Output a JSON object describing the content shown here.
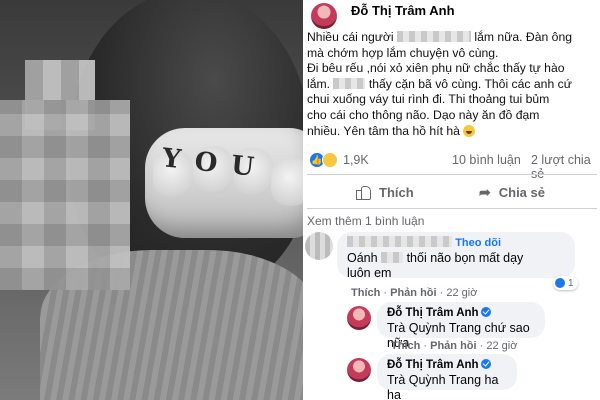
{
  "post": {
    "author": "Đỗ Thị Trâm Anh",
    "text": {
      "line1_a": "Nhiều cái người",
      "line1_b": "lắm nữa. Đàn ông",
      "line2": "mà chớm hợp lắm chuyện vô cùng.",
      "line3": "Đi bêu rếu ,nói xỏ xiên phụ nữ chắc thấy tự hào",
      "line4_a": "lắm.",
      "line4_b": "thấy cặn bã vô cùng. Thôi các anh cứ",
      "line5": "chui xuống váy tui rình đi. Thi thoảng tui bủm",
      "line6": "cho cái cho thông não. Dạo này ăn đồ đạm",
      "line7": "nhiều. Yên tâm tha hồ hít hà"
    },
    "reaction_count": "1,9K",
    "comment_count": "10 bình luận",
    "share_count": "2 lượt chia sẻ",
    "actions": {
      "like": "Thích",
      "share": "Chia sẻ"
    },
    "see_more": "Xem thêm 1 bình luận"
  },
  "photo": {
    "knuckle_text": "YOU"
  },
  "comments": [
    {
      "follow": "Theo dõi",
      "text_a": "Oánh",
      "text_b": "thối não bọn mất dạy",
      "text_c": "luôn em",
      "like": "Thích",
      "reply": "Phản hồi",
      "time": "22 giờ",
      "likes": "1"
    },
    {
      "name": "Đỗ Thị Trâm Anh",
      "mention": "Trà Quỳnh Trang",
      "text": "chứ sao nữa",
      "like": "Thích",
      "reply": "Phản hồi",
      "time": "22 giờ"
    },
    {
      "name": "Đỗ Thị Trâm Anh",
      "mention": "Trà Quỳnh Trang",
      "text": "ha ha"
    }
  ],
  "colors": {
    "link": "#1877f2",
    "muted": "#65676b",
    "bubble": "#f0f2f5"
  }
}
